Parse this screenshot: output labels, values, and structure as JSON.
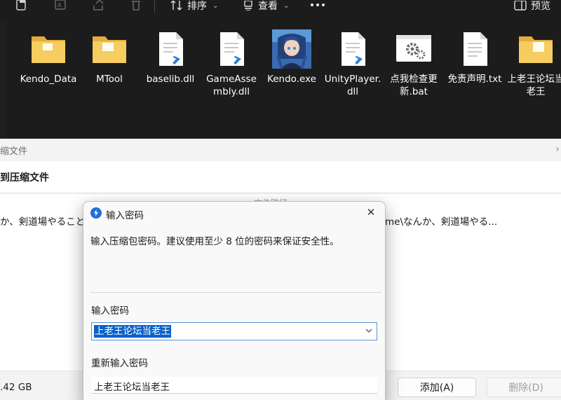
{
  "toolbar": {
    "sort_label": "排序",
    "view_label": "查看",
    "preview_label": "预览",
    "icons": [
      "new-folder-icon",
      "ai-icon",
      "share-icon",
      "delete-icon",
      "sort-icon",
      "view-icon",
      "more-icon",
      "preview-pane-icon"
    ]
  },
  "files": [
    {
      "name": "Kendo_Data",
      "type": "folder"
    },
    {
      "name": "MTool",
      "type": "folder"
    },
    {
      "name": "baselib.dll",
      "type": "dll"
    },
    {
      "name": "GameAssembly.dll",
      "type": "dll"
    },
    {
      "name": "Kendo.exe",
      "type": "exe"
    },
    {
      "name": "UnityPlayer.dll",
      "type": "dll"
    },
    {
      "name": "点我检查更新.bat",
      "type": "bat"
    },
    {
      "name": "免责声明.txt",
      "type": "txt"
    },
    {
      "name": "上老王论坛当老王",
      "type": "folder"
    }
  ],
  "archive_window": {
    "title": "缩文件",
    "header": "到压缩文件",
    "column_header": "文件路径",
    "row_left": "か、剣道場やること",
    "row_right": "me\\なんか、剣道場やる...",
    "size": ".42 GB",
    "add_button": "添加(A)",
    "delete_button": "删除(D)"
  },
  "dialog": {
    "title": "输入密码",
    "message": "输入压缩包密码。建议使用至少 8 位的密码来保证安全性。",
    "password_label": "输入密码",
    "password_value": "上老王论坛当老王",
    "reenter_label": "重新输入密码",
    "reenter_value": "上老王论坛当老王"
  },
  "colors": {
    "explorer_bg": "#1c1c1c",
    "folder_yellow": "#f4c95d",
    "selection_blue": "#0a62c9",
    "dialog_bg": "#f9f9f9"
  }
}
